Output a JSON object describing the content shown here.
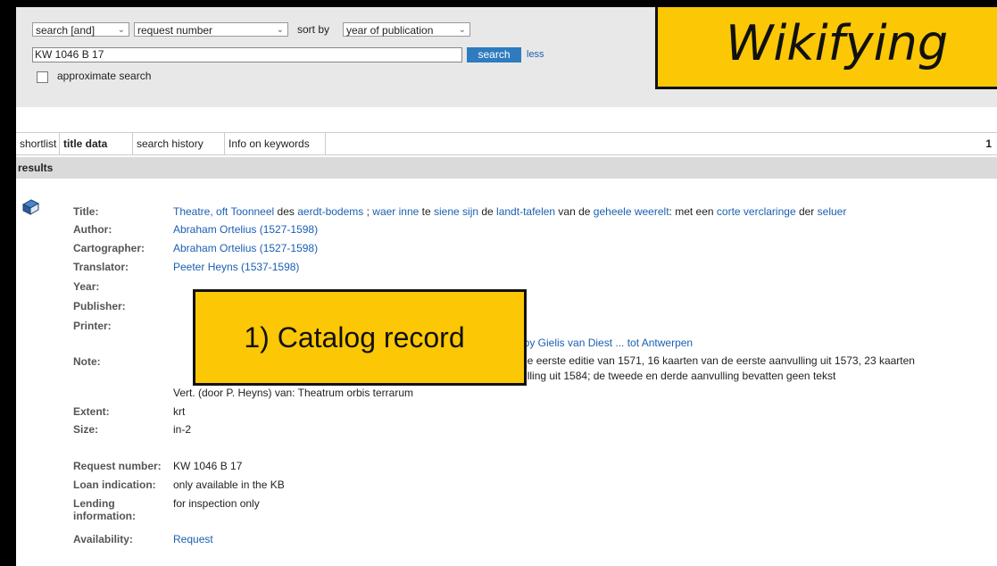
{
  "search": {
    "operator": "search [and]",
    "field": "request number",
    "sort_label": "sort by",
    "sort_value": "year of publication",
    "query": "KW 1046 B 17",
    "button": "search",
    "less": "less",
    "approx_label": "approximate search"
  },
  "tabs": [
    "shortlist",
    "title data",
    "search history",
    "Info on keywords"
  ],
  "page_number": "1",
  "results_label": "results",
  "record": {
    "title_label": "Title:",
    "title_parts": [
      "Theatre, oft Toonneel",
      " des ",
      "aerdt-bodems",
      " ; ",
      "waer inne",
      " te ",
      "siene sijn",
      " de ",
      "landt-tafelen",
      " van de ",
      "geheele weerelt",
      ": met een ",
      "corte verclaringe",
      " der ",
      "seluer"
    ],
    "author_label": "Author:",
    "author": "Abraham Ortelius (1527-1598)",
    "cartographer_label": "Cartographer:",
    "cartographer": "Abraham Ortelius (1527-1598)",
    "translator_label": "Translator:",
    "translator": "Peeter Heyns (1537-1598)",
    "year_label": "Year:",
    "publisher_label": "Publisher:",
    "printer_label": "Printer:",
    "printer_value": "ckt by Gielis van Diest ... tot Antwerpen",
    "note_label": "Note:",
    "note_line1": "uit de eerste editie van 1571, 16 kaarten van de eerste aanvulling uit 1573, 23 kaarten",
    "note_line2": "aanvulling uit 1584; de tweede en derde aanvulling bevatten geen tekst",
    "note_line3": "Vert. (door P. Heyns) van: Theatrum orbis terrarum",
    "extent_label": "Extent:",
    "extent": "krt",
    "size_label": "Size:",
    "size": "in-2",
    "request_label": "Request number:",
    "request": "KW 1046 B 17",
    "loan_label": "Loan indication:",
    "loan": "only available in the KB",
    "lending_label_1": "Lending",
    "lending_label_2": "information:",
    "lending": "for inspection only",
    "availability_label": "Availability:",
    "availability": "Request"
  },
  "overlay": {
    "wikify": "Wikifying",
    "callout": "1) Catalog record"
  }
}
